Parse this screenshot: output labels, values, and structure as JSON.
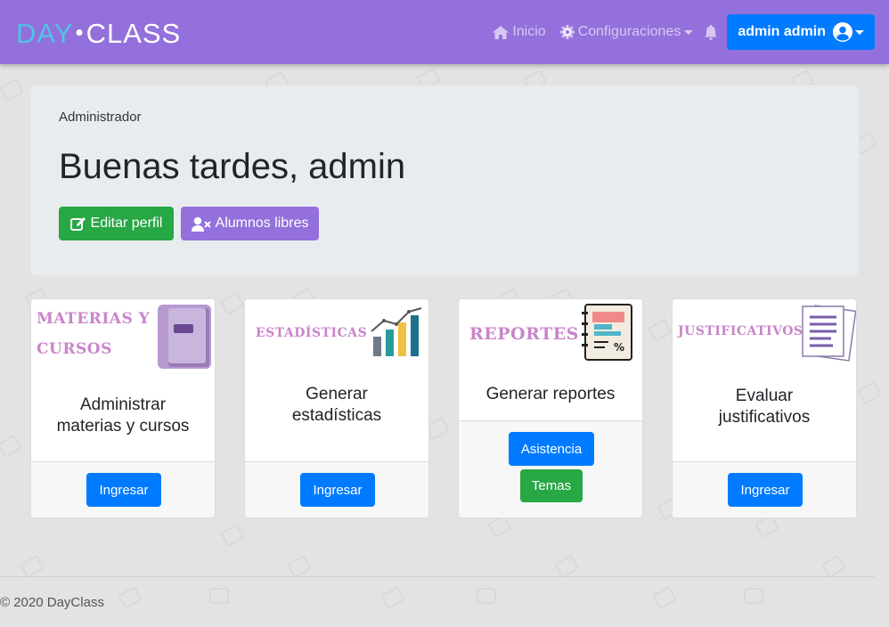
{
  "brand": {
    "part1": "DAY",
    "dot": "•",
    "part2": "CLASS"
  },
  "nav": {
    "inicio": "Inicio",
    "configuraciones": "Configuraciones",
    "user": "admin admin"
  },
  "jumbotron": {
    "role": "Administrador",
    "greeting": "Buenas tardes, admin",
    "edit_button": "Editar perfil",
    "libres_button": "Alumnos libres"
  },
  "cards": [
    {
      "image_label_line1": "MATERIAS Y",
      "image_label_line2": "CURSOS",
      "title_line1": "Administrar",
      "title_line2": "materias y cursos",
      "button": "Ingresar"
    },
    {
      "image_label": "ESTADÍSTICAS",
      "title_line1": "Generar",
      "title_line2": "estadísticas",
      "button": "Ingresar"
    },
    {
      "image_label": "REPORTES",
      "title": "Generar reportes",
      "button1": "Asistencia",
      "button2": "Temas"
    },
    {
      "image_label": "JUSTIFICATIVOS",
      "title_line1": "Evaluar",
      "title_line2": "justificativos",
      "button": "Ingresar"
    }
  ],
  "footer": {
    "copyright": "© 2020 DayClass"
  },
  "colors": {
    "navbar": "#9370db",
    "primary": "#007bff",
    "success": "#28a745",
    "accent_label": "#c985c9"
  }
}
